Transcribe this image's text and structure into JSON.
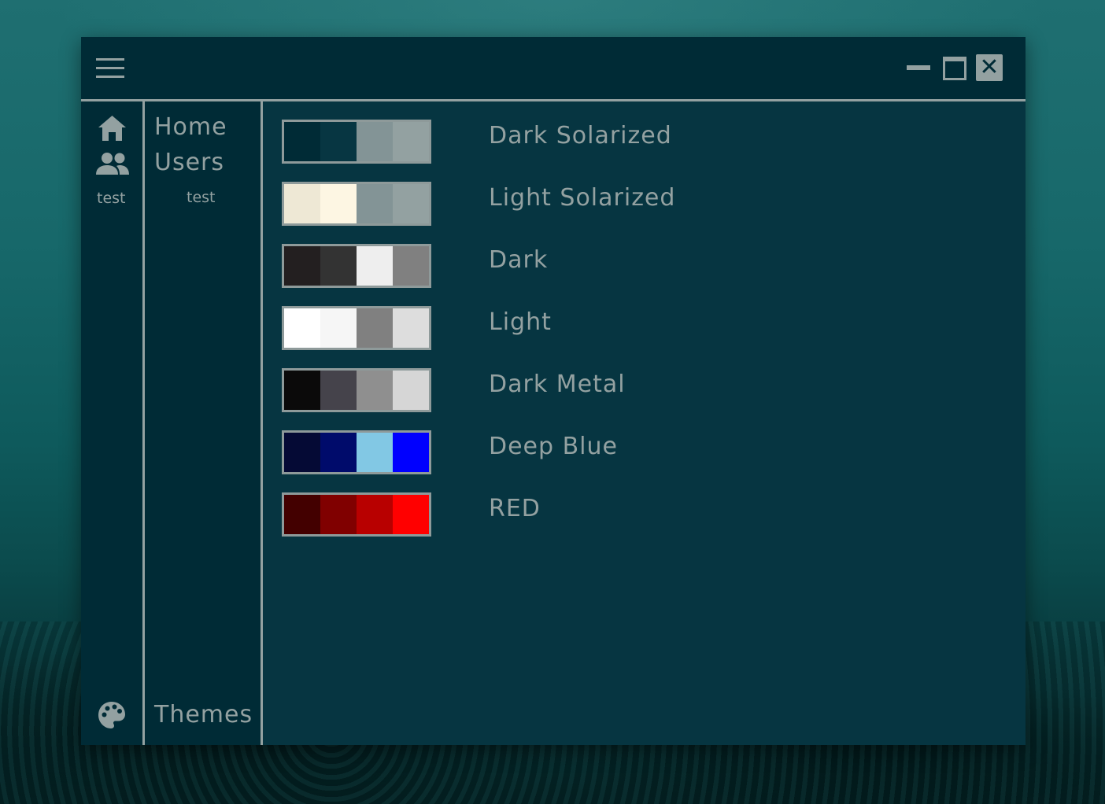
{
  "window": {
    "controls": {
      "menu_icon": "hamburger-icon",
      "minimize_icon": "minimize-icon",
      "maximize_icon": "maximize-icon",
      "close_icon": "close-icon",
      "close_glyph": "✕"
    }
  },
  "sidebar": {
    "icons": [
      {
        "name": "home-icon"
      },
      {
        "name": "users-icon"
      }
    ],
    "icon_text": "test",
    "items": [
      {
        "label": "Home"
      },
      {
        "label": "Users"
      }
    ],
    "sub_item": "test",
    "bottom_icon": "palette-icon",
    "bottom_label": "Themes"
  },
  "themes": [
    {
      "name": "Dark Solarized",
      "colors": [
        "#002b36",
        "#073642",
        "#839496",
        "#93a1a1"
      ]
    },
    {
      "name": "Light Solarized",
      "colors": [
        "#eee8d5",
        "#fdf6e3",
        "#839496",
        "#93a1a1"
      ]
    },
    {
      "name": "Dark",
      "colors": [
        "#231f20",
        "#333333",
        "#eeeeee",
        "#808080"
      ]
    },
    {
      "name": "Light",
      "colors": [
        "#ffffff",
        "#f6f6f6",
        "#808080",
        "#dddddd"
      ]
    },
    {
      "name": "Dark Metal",
      "colors": [
        "#0b0a0a",
        "#45434b",
        "#8f8f8f",
        "#d6d6d6"
      ]
    },
    {
      "name": "Deep Blue",
      "colors": [
        "#050a35",
        "#000b6b",
        "#82c8e4",
        "#0000ff"
      ]
    },
    {
      "name": "RED",
      "colors": [
        "#430000",
        "#800000",
        "#b80000",
        "#ff0000"
      ]
    }
  ],
  "colors": {
    "background": "#063541",
    "panel": "#002b36",
    "accent": "#93a1a1"
  }
}
